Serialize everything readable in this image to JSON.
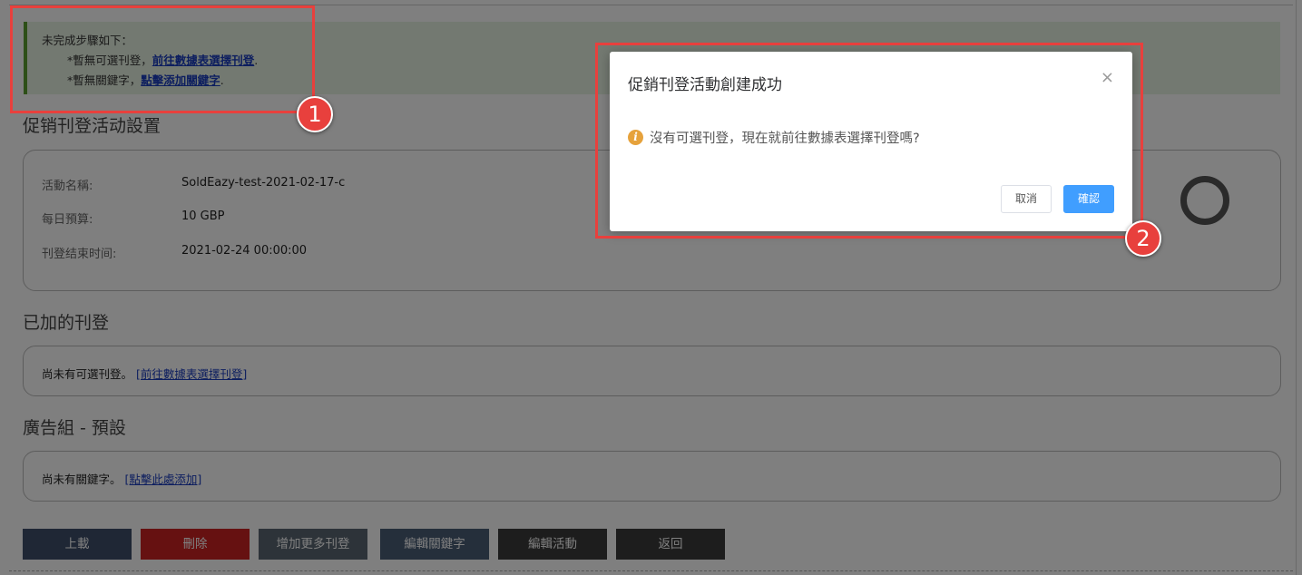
{
  "notice": {
    "heading": "未完成步驟如下：",
    "step1_prefix": "*暫無可選刊登，",
    "step1_link": "前往數據表選擇刊登",
    "step1_suffix": ".",
    "step2_prefix": "*暫無關鍵字，",
    "step2_link": "點擊添加關鍵字",
    "step2_suffix": "."
  },
  "settings": {
    "title": "促销刊登活动設置",
    "rows": [
      {
        "label": "活動名稱:",
        "value": "SoldEazy-test-2021-02-17-c"
      },
      {
        "label": "每日預算:",
        "value": "10 GBP"
      },
      {
        "label": "刊登结束时间:",
        "value": "2021-02-24 00:00:00"
      }
    ]
  },
  "listings": {
    "title": "已加的刊登",
    "empty_text": "尚未有可選刊登。",
    "link": "[前往數據表選擇刊登]"
  },
  "adgroup": {
    "title": "廣告組 - 預設",
    "empty_text": "尚未有關鍵字。",
    "link": "[點擊此處添加]"
  },
  "buttons": {
    "upload": "上載",
    "delete": "刪除",
    "add_more": "增加更多刊登",
    "edit_keywords": "編輯關鍵字",
    "edit_campaign": "編輯活動",
    "back": "返回"
  },
  "modal": {
    "title": "促銷刊登活動創建成功",
    "close_glyph": "×",
    "message": "沒有可選刊登，現在就前往數據表選擇刊登嗎?",
    "cancel": "取消",
    "confirm": "確認"
  },
  "annotations": {
    "badge1": "1",
    "badge2": "2"
  },
  "colors": {
    "highlight": "#e8403d",
    "confirm": "#409eff",
    "delete": "#cc2323"
  }
}
